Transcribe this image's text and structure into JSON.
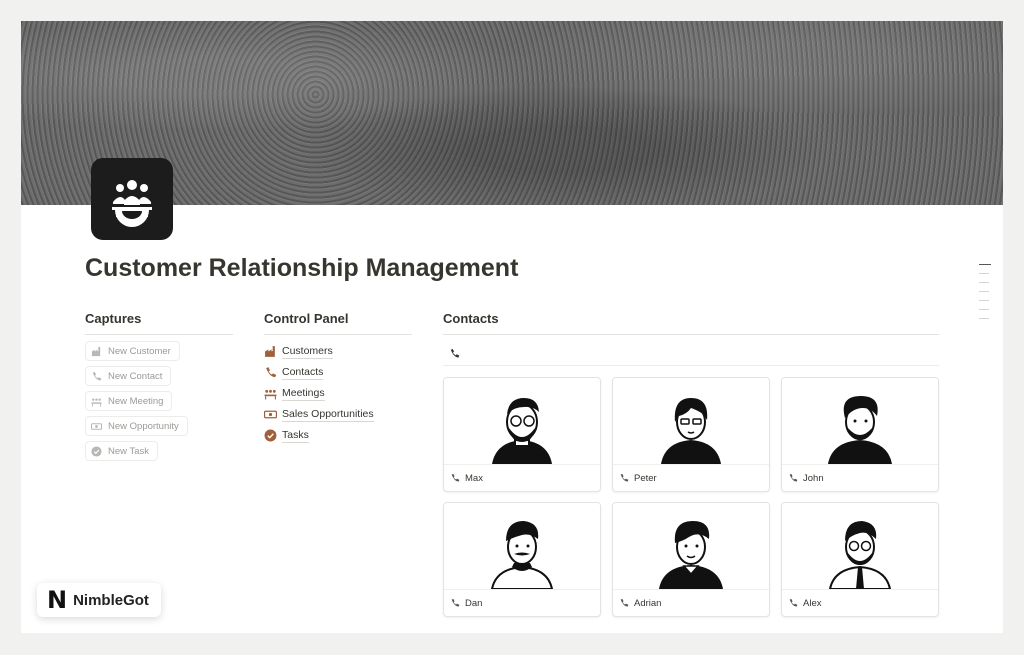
{
  "page": {
    "title": "Customer Relationship Management",
    "icon": "team-gear-icon"
  },
  "captures": {
    "heading": "Captures",
    "buttons": [
      {
        "label": "New Customer",
        "icon": "factory-icon"
      },
      {
        "label": "New Contact",
        "icon": "phone-icon"
      },
      {
        "label": "New Meeting",
        "icon": "meeting-icon"
      },
      {
        "label": "New Opportunity",
        "icon": "money-icon"
      },
      {
        "label": "New Task",
        "icon": "check-circle-icon"
      }
    ]
  },
  "control_panel": {
    "heading": "Control Panel",
    "links": [
      {
        "label": "Customers",
        "icon": "factory-icon"
      },
      {
        "label": "Contacts",
        "icon": "phone-icon"
      },
      {
        "label": "Meetings",
        "icon": "meeting-icon"
      },
      {
        "label": "Sales Opportunities",
        "icon": "money-icon"
      },
      {
        "label": "Tasks",
        "icon": "check-circle-icon"
      }
    ]
  },
  "contacts": {
    "heading": "Contacts",
    "view_icon": "phone-icon",
    "cards": [
      {
        "name": "Max"
      },
      {
        "name": "Peter"
      },
      {
        "name": "John"
      },
      {
        "name": "Dan"
      },
      {
        "name": "Adrian"
      },
      {
        "name": "Alex"
      }
    ]
  },
  "brand": {
    "mark": "N",
    "name": "NimbleGot"
  },
  "colors": {
    "icon_accent": "#a0603b",
    "text": "#37352f",
    "muted": "#9b9a97"
  }
}
